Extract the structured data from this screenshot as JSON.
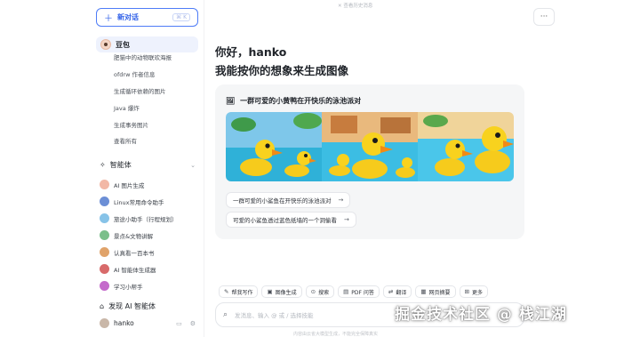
{
  "sidebar": {
    "new_chat": {
      "label": "新对话",
      "shortcut": "⌘ K"
    },
    "bot": {
      "name": "豆包"
    },
    "history": [
      "肥猫中的动物联欢海报",
      "ofdrw 作者信息",
      "生成循环依赖的图片",
      "Java 爆炸",
      "生成事务图片"
    ],
    "see_all": "查看所有",
    "agents": {
      "title": "智能体",
      "items": [
        {
          "label": "AI 图片生成",
          "color": "#f2b8a6"
        },
        {
          "label": "Linux常用命令助手",
          "color": "#6c8fd6"
        },
        {
          "label": "旅途小助手（行程规划）",
          "color": "#87c3e8"
        },
        {
          "label": "景点&文物讲解",
          "color": "#7bbf8a"
        },
        {
          "label": "认真看一百本书",
          "color": "#e0a36a"
        },
        {
          "label": "AI 智能体生成器",
          "color": "#d86a6a"
        },
        {
          "label": "学习小帮手",
          "color": "#c46acb"
        }
      ]
    },
    "discover": "发现 AI 智能体",
    "user": {
      "name": "hanko"
    }
  },
  "main": {
    "top_hint": "✕ 查看历史消息",
    "greeting": "你好，hanko",
    "subtitle": "我能按你的想象来生成图像",
    "card": {
      "title": "一群可爱的小黄鸭在开快乐的泳池派对",
      "suggestions": [
        "一群可爱的小鲨鱼在开快乐的泳池派对",
        "可爱的小鲨鱼透过蓝色纸墙的一个洞偷看"
      ]
    },
    "tools": [
      {
        "icon": "pen-icon",
        "label": "帮我写作"
      },
      {
        "icon": "image-icon",
        "label": "图像生成"
      },
      {
        "icon": "search-icon",
        "label": "搜索"
      },
      {
        "icon": "pdf-icon",
        "label": "PDF 问答"
      },
      {
        "icon": "translate-icon",
        "label": "翻译"
      },
      {
        "icon": "web-icon",
        "label": "网页摘要"
      },
      {
        "icon": "grid-icon",
        "label": "更多"
      }
    ],
    "input": {
      "placeholder": "发消息、输入 @ 或 / 选择技能"
    },
    "footer": "内容由云雀大模型生成，不能完全保障真实"
  },
  "watermark": "掘金技术社区 @ 栈江湖",
  "colors": {
    "accent": "#3161e8",
    "card_bg": "#f5f6f7",
    "active_bg": "#eef2fd"
  }
}
